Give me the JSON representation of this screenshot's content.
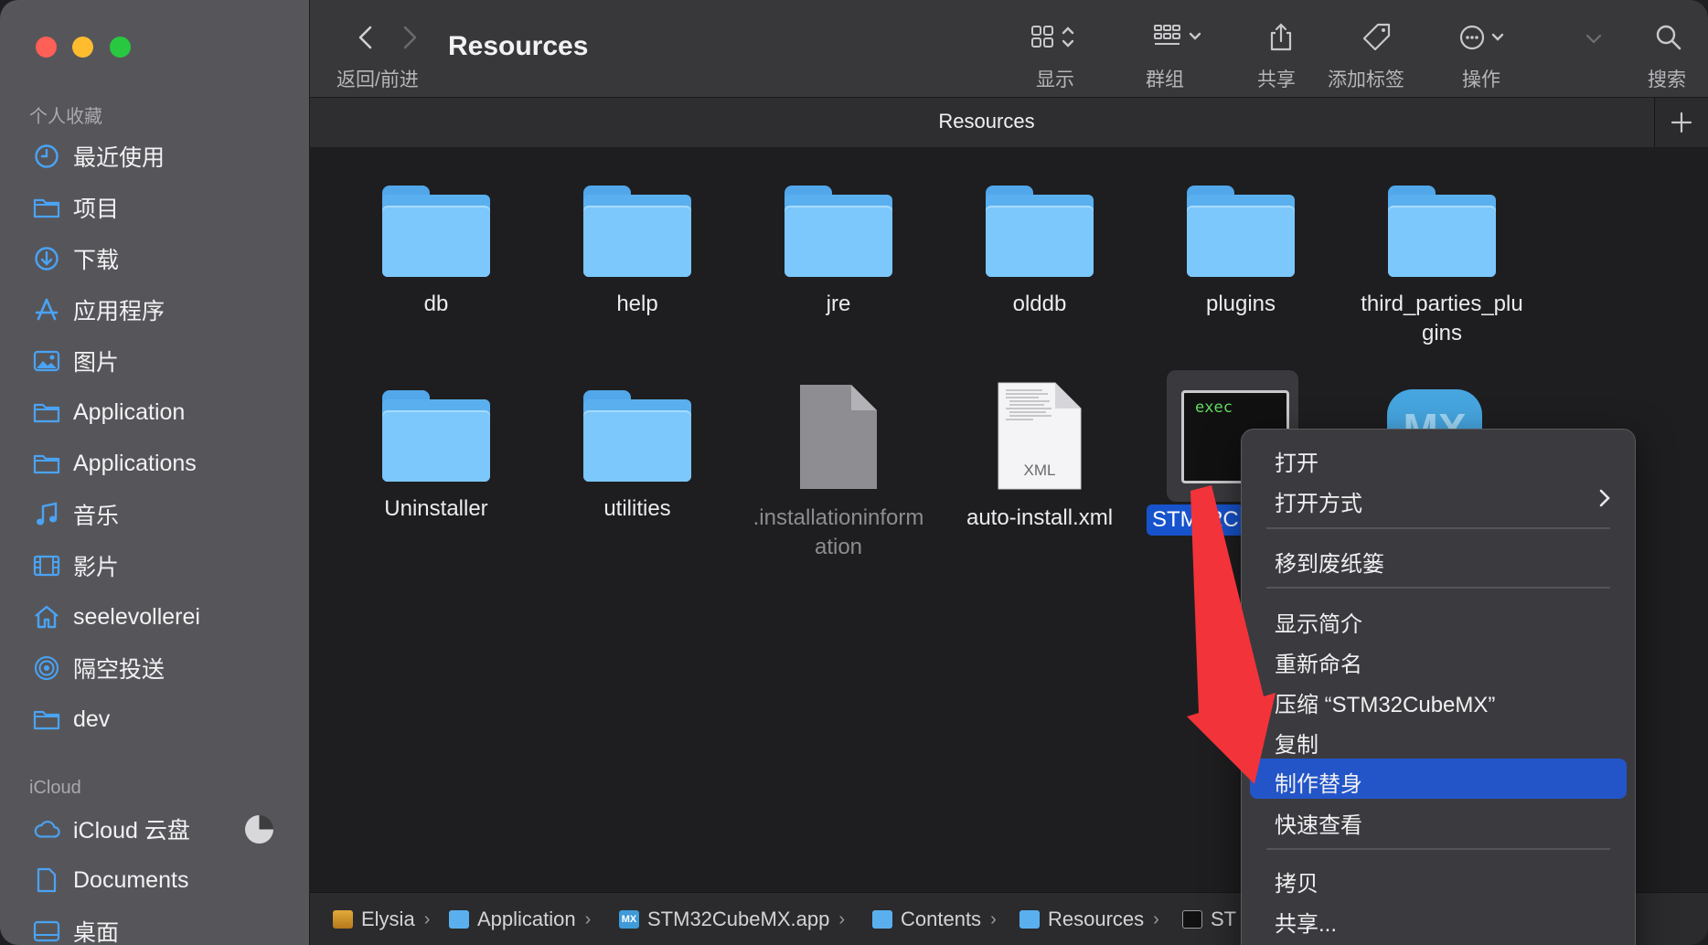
{
  "window": {
    "title": "Resources"
  },
  "toolbar": {
    "nav_label": "返回/前进",
    "title": "Resources",
    "buttons": [
      {
        "label": "显示",
        "icon": "grid-icon"
      },
      {
        "label": "群组",
        "icon": "group-icon"
      },
      {
        "label": "共享",
        "icon": "share-icon"
      },
      {
        "label": "添加标签",
        "icon": "tag-icon"
      },
      {
        "label": "操作",
        "icon": "more-icon"
      },
      {
        "label": "搜索",
        "icon": "search-icon"
      }
    ]
  },
  "pathbar_title": "Resources",
  "sidebar": {
    "favorites_title": "个人收藏",
    "items": [
      {
        "label": "最近使用",
        "icon": "clock-icon"
      },
      {
        "label": "项目",
        "icon": "folder-icon"
      },
      {
        "label": "下载",
        "icon": "download-icon"
      },
      {
        "label": "应用程序",
        "icon": "apps-icon"
      },
      {
        "label": "图片",
        "icon": "photo-icon"
      },
      {
        "label": "Application",
        "icon": "folder-icon"
      },
      {
        "label": "Applications",
        "icon": "folder-icon"
      },
      {
        "label": "音乐",
        "icon": "music-icon"
      },
      {
        "label": "影片",
        "icon": "film-icon"
      },
      {
        "label": "seelevollerei",
        "icon": "home-icon"
      },
      {
        "label": "隔空投送",
        "icon": "airdrop-icon"
      },
      {
        "label": "dev",
        "icon": "folder-icon"
      }
    ],
    "icloud_title": "iCloud",
    "icloud_items": [
      {
        "label": "iCloud 云盘",
        "icon": "cloud-icon"
      },
      {
        "label": "Documents",
        "icon": "document-icon"
      },
      {
        "label": "桌面",
        "icon": "desktop-icon"
      }
    ]
  },
  "files": [
    {
      "name": "db",
      "type": "folder"
    },
    {
      "name": "help",
      "type": "folder"
    },
    {
      "name": "jre",
      "type": "folder"
    },
    {
      "name": "olddb",
      "type": "folder"
    },
    {
      "name": "plugins",
      "type": "folder"
    },
    {
      "name": "third_parties_plugins",
      "type": "folder",
      "line1": "third_parties_plu",
      "line2": "gins"
    },
    {
      "name": "Uninstaller",
      "type": "folder"
    },
    {
      "name": "utilities",
      "type": "folder"
    },
    {
      "name": ".installationinformation",
      "type": "document",
      "line1": ".installationinform",
      "line2": "ation"
    },
    {
      "name": "auto-install.xml",
      "type": "xml",
      "badge": "XML"
    },
    {
      "name": "STM32C",
      "type": "exec",
      "badge": "exec",
      "selected": true
    },
    {
      "name": "MX",
      "type": "app"
    }
  ],
  "context_menu": {
    "items": [
      {
        "label": "打开"
      },
      {
        "label": "打开方式",
        "submenu": true
      },
      {
        "label": "移到废纸篓"
      },
      {
        "label": "显示简介"
      },
      {
        "label": "重新命名"
      },
      {
        "label": "压缩 “STM32CubeMX”"
      },
      {
        "label": "复制"
      },
      {
        "label": "制作替身",
        "highlighted": true
      },
      {
        "label": "快速查看"
      },
      {
        "label": "拷贝"
      },
      {
        "label": "共享..."
      }
    ]
  },
  "breadcrumb": [
    {
      "label": "Elysia",
      "icon": "disk-icon"
    },
    {
      "label": "Application",
      "icon": "folder-icon"
    },
    {
      "label": "STM32CubeMX.app",
      "icon": "app-icon"
    },
    {
      "label": "Contents",
      "icon": "folder-icon"
    },
    {
      "label": "Resources",
      "icon": "folder-icon"
    },
    {
      "label": "ST",
      "icon": "terminal-icon"
    }
  ],
  "colors": {
    "accent": "#2355c9",
    "folder": "#7cc7fb",
    "arrow": "#f2333a",
    "sidebar_icon": "#4aa3f5"
  }
}
